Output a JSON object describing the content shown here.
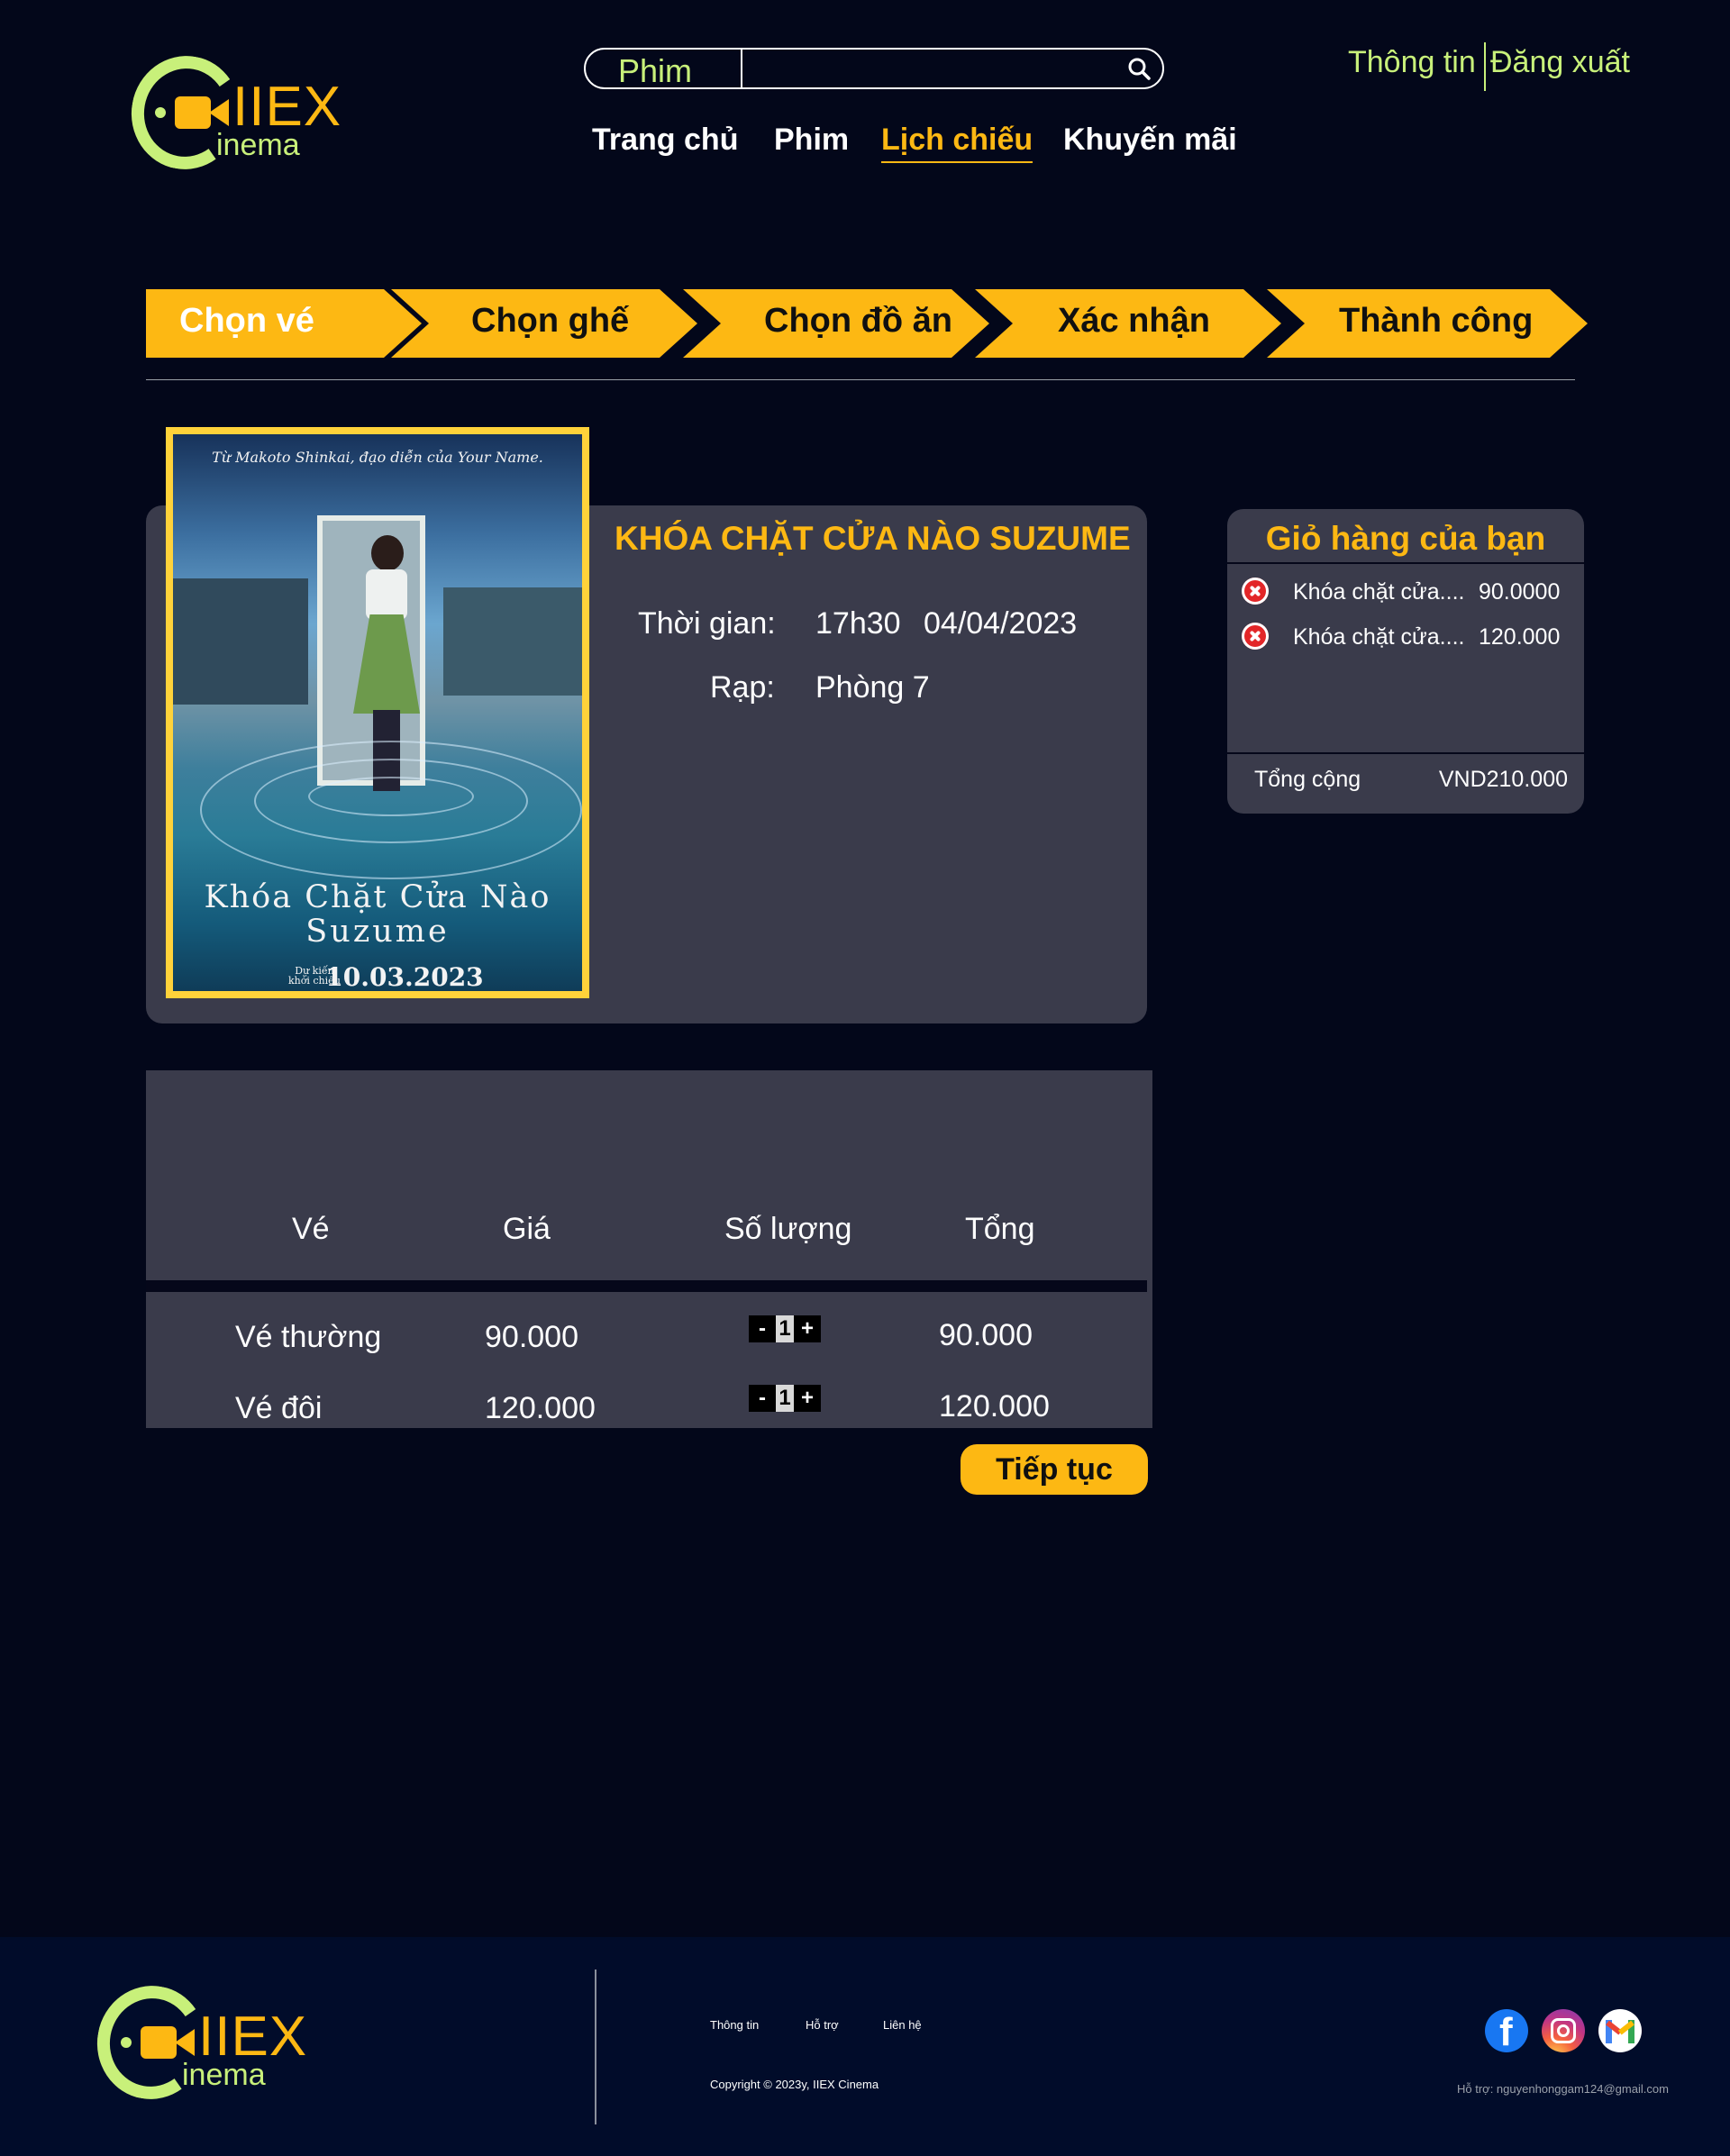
{
  "header": {
    "logo": {
      "brand": "IIEX",
      "sub": "inema"
    },
    "search": {
      "category": "Phim",
      "placeholder": ""
    },
    "nav": [
      "Trang chủ",
      "Phim",
      "Lịch chiếu",
      "Khuyến mãi"
    ],
    "nav_active": "Lịch chiếu",
    "account": {
      "info": "Thông tin",
      "logout": "Đăng xuất"
    }
  },
  "steps": [
    "Chọn vé",
    "Chọn ghế",
    "Chọn đồ ăn",
    "Xác nhận",
    "Thành công"
  ],
  "steps_active": "Chọn vé",
  "movie": {
    "title": "KHÓA CHẶT CỬA NÀO SUZUME",
    "time_label": "Thời gian:",
    "time": "17h30",
    "date": "04/04/2023",
    "room_label": "Rạp:",
    "room": "Phòng 7",
    "poster": {
      "tagline": "Từ Makoto Shinkai, đạo diễn của Your Name.",
      "title_line1": "Khóa Chặt Cửa Nào",
      "title_line2": "Suzume",
      "release_label_1": "Dự kiến",
      "release_label_2": "khởi chiếu",
      "release_date": "10.03.2023"
    }
  },
  "cart": {
    "title": "Giỏ hàng của bạn",
    "items": [
      {
        "name": "Khóa chặt cửa....",
        "price": "90.0000"
      },
      {
        "name": "Khóa chặt cửa....",
        "price": "120.000"
      }
    ],
    "total_label": "Tổng cộng",
    "total_value": "VND210.000"
  },
  "tickets": {
    "headers": [
      "Vé",
      "Giá",
      "Số lượng",
      "Tổng"
    ],
    "rows": [
      {
        "type": "Vé thường",
        "price": "90.000",
        "qty": "1",
        "total": "90.000"
      },
      {
        "type": "Vé đôi",
        "price": "120.000",
        "qty": "1",
        "total": "120.000"
      }
    ],
    "minus": "-",
    "plus": "+"
  },
  "continue_label": "Tiếp tục",
  "footer": {
    "links": [
      "Thông tin",
      "Hỗ trợ",
      "Liên hệ"
    ],
    "copyright": "Copyright © 2023y, IIEX Cinema",
    "support": "Hỗ trợ: nguyenhonggam124@gmail.com"
  },
  "colors": {
    "background": "#03071a",
    "accent": "#fdb813",
    "lime": "#c8f07a",
    "panel": "#3a3b4b",
    "footer": "#010c2a"
  },
  "icons": [
    "search-icon",
    "remove-item-icon",
    "facebook-icon",
    "instagram-icon",
    "gmail-icon",
    "camera-logo-icon"
  ]
}
